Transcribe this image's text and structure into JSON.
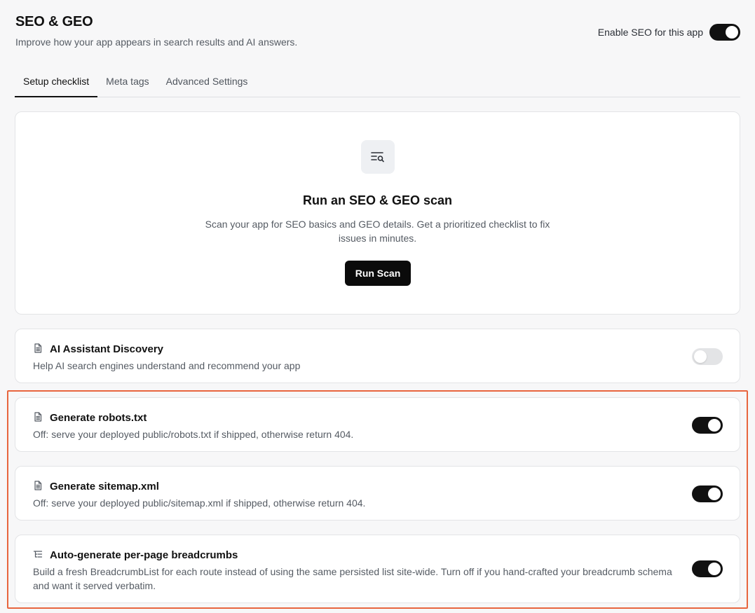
{
  "header": {
    "title": "SEO & GEO",
    "subtitle": "Improve how your app appears in search results and AI answers.",
    "enable_label": "Enable SEO for this app",
    "enabled": true
  },
  "tabs": [
    {
      "label": "Setup checklist",
      "active": true
    },
    {
      "label": "Meta tags",
      "active": false
    },
    {
      "label": "Advanced Settings",
      "active": false
    }
  ],
  "scan": {
    "icon": "search-list-icon",
    "title": "Run an SEO & GEO scan",
    "description_line1": "Scan your app for SEO basics and GEO details. Get a prioritized checklist to fix",
    "description_line2": "issues in minutes.",
    "button_label": "Run Scan"
  },
  "features": [
    {
      "icon": "document-icon",
      "title": "AI Assistant Discovery",
      "description": "Help AI search engines understand and recommend your app",
      "enabled": false
    },
    {
      "icon": "document-icon",
      "title": "Generate robots.txt",
      "description": "Off: serve your deployed public/robots.txt if shipped, otherwise return 404.",
      "enabled": true
    },
    {
      "icon": "document-icon",
      "title": "Generate sitemap.xml",
      "description": "Off: serve your deployed public/sitemap.xml if shipped, otherwise return 404.",
      "enabled": true
    },
    {
      "icon": "list-tree-icon",
      "title": "Auto-generate per-page breadcrumbs",
      "description": "Build a fresh BreadcrumbList for each route instead of using the same persisted list site-wide. Turn off if you hand-crafted your breadcrumb schema and want it served verbatim.",
      "enabled": true
    }
  ],
  "colors": {
    "accent": "#111111",
    "highlight": "#e8653e",
    "background": "#f7f7f8"
  }
}
